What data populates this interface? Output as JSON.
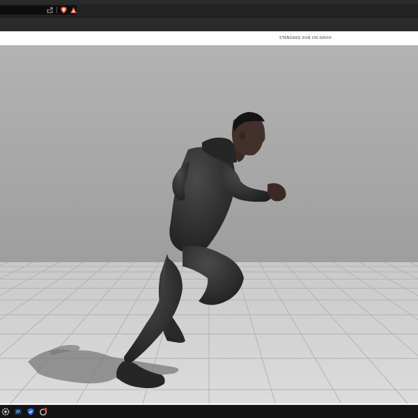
{
  "browser": {
    "toolbar_icons": [
      "share-icon",
      "brave-shield-icon",
      "brave-rewards-icon"
    ]
  },
  "viewer": {
    "animation_title": "STANDARD RUN ON DAVID"
  },
  "taskbar": {
    "icons": [
      "settings-icon",
      "app-icon",
      "shield-icon",
      "browser-icon"
    ],
    "colors": {
      "background": "#141414"
    }
  },
  "colors": {
    "wall": "#a7a7a7",
    "floor": "#cfcfcf",
    "grid": "#b5b5b5",
    "character": "#2b2b2b"
  }
}
